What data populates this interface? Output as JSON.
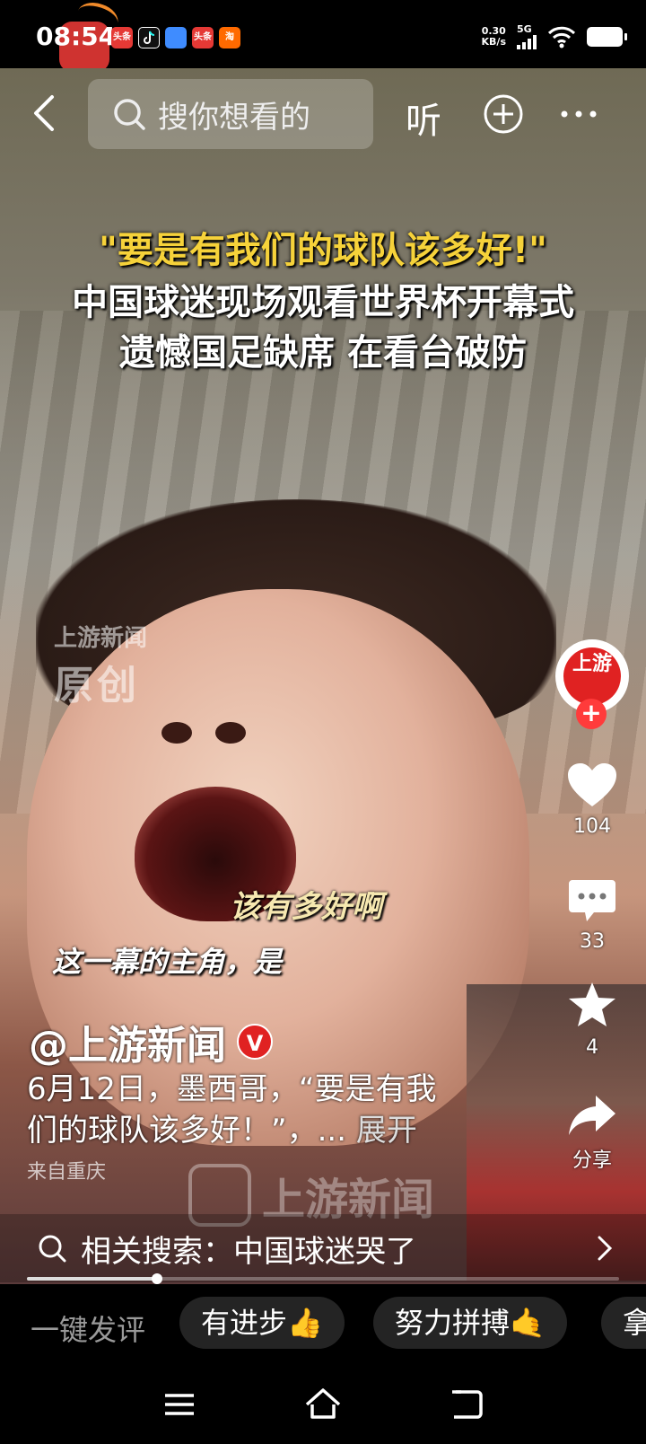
{
  "status_bar": {
    "time": "08:54",
    "net_speed_value": "0.30",
    "net_speed_unit": "KB/s",
    "network": "5G",
    "notif_icons": [
      "头条",
      "tiktok-icon",
      "app-icon",
      "头条",
      "淘"
    ]
  },
  "top_bar": {
    "search_placeholder": "搜你想看的",
    "listen_label": "听"
  },
  "video": {
    "headline_line1": "\"要是有我们的球队该多好!\"",
    "headline_line2": "中国球迷现场观看世界杯开幕式",
    "headline_line3": "遗憾国足缺席 在看台破防",
    "watermark_line1": "上游新闻",
    "watermark_line2": "原创",
    "caption_1": "该有多好啊",
    "caption_2": "这一幕的主角，是",
    "bottom_watermark": "上游新闻"
  },
  "rail": {
    "avatar_text": "上游",
    "likes": "104",
    "comments": "33",
    "favorites": "4",
    "share_label": "分享"
  },
  "info": {
    "author": "@上游新闻",
    "verified_mark": "V",
    "desc_line1": "6月12日，墨西哥，“要是有我",
    "desc_line2": "们的球队该多好！”，...",
    "expand_label": "展开",
    "location": "来自重庆"
  },
  "related_search": {
    "label": "相关搜索：中国球迷哭了"
  },
  "progress": {
    "fraction": 0.22
  },
  "quick_comment": {
    "label": "一键发评",
    "chips": [
      "有进步👍",
      "努力拼搏🤙",
      "拿"
    ]
  },
  "colors": {
    "accent_red": "#e02222",
    "headline_yellow": "#f6d23a"
  }
}
